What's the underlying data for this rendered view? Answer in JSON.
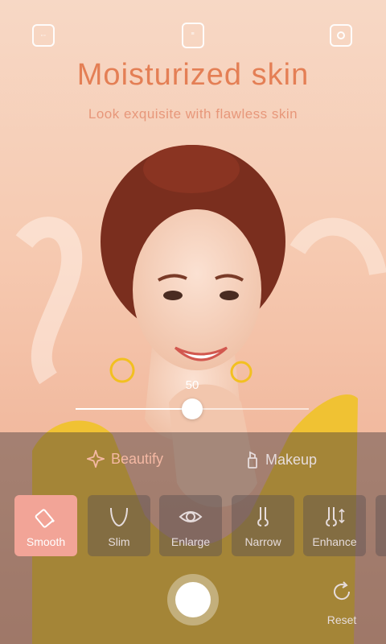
{
  "top_bar": {
    "left_icon": "aspect-ratio-icon",
    "middle_icon": "gallery-icon",
    "right_icon": "switch-camera-icon"
  },
  "hero": {
    "title": "Moisturized skin",
    "subtitle": "Look exquisite with flawless skin"
  },
  "slider": {
    "value": "50",
    "fraction": 0.5
  },
  "categories": [
    {
      "label": "Beautify",
      "icon": "sparkle-icon",
      "active": true
    },
    {
      "label": "Makeup",
      "icon": "lipstick-icon",
      "active": false
    }
  ],
  "tools": [
    {
      "label": "Smooth",
      "icon": "eraser-icon",
      "active": true
    },
    {
      "label": "Slim",
      "icon": "face-slim-icon",
      "active": false
    },
    {
      "label": "Enlarge",
      "icon": "eye-icon",
      "active": false
    },
    {
      "label": "Narrow",
      "icon": "nose-narrow-icon",
      "active": false
    },
    {
      "label": "Enhance",
      "icon": "nose-enhance-icon",
      "active": false
    }
  ],
  "reset": {
    "label": "Reset",
    "icon": "reset-icon"
  },
  "colors": {
    "accent": "#e47f55",
    "active_tool": "#f2a497",
    "active_category": "#f4b8a3"
  }
}
